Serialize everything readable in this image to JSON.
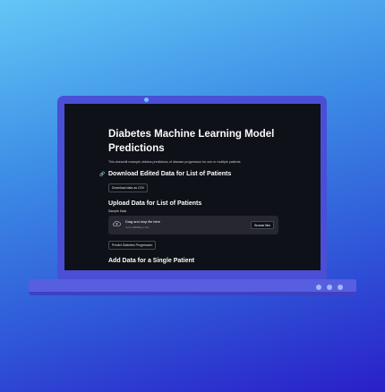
{
  "app": {
    "title": "Diabetes Machine Learning Model Predictions",
    "caption": "This streamlit example obtains predictions of disease progression for one or multiple patients.",
    "section_download": "Download Edited Data for List of Patients",
    "download_button": "Download data as CSV",
    "section_upload": "Upload Data for List of Patients",
    "upload_label": "Sample Data",
    "uploader": {
      "drop_text": "Drag and drop file here",
      "limit_text": "Limit 200MB per file",
      "browse_button": "Browse files"
    },
    "predict_button": "Predict Diabetes Progression",
    "section_single": "Add Data for a Single Patient"
  },
  "colors": {
    "background_top": "#64c6f6",
    "background_bottom": "#2a1fc8",
    "laptop": "#4a4fd6",
    "screen": "#0e1117"
  }
}
